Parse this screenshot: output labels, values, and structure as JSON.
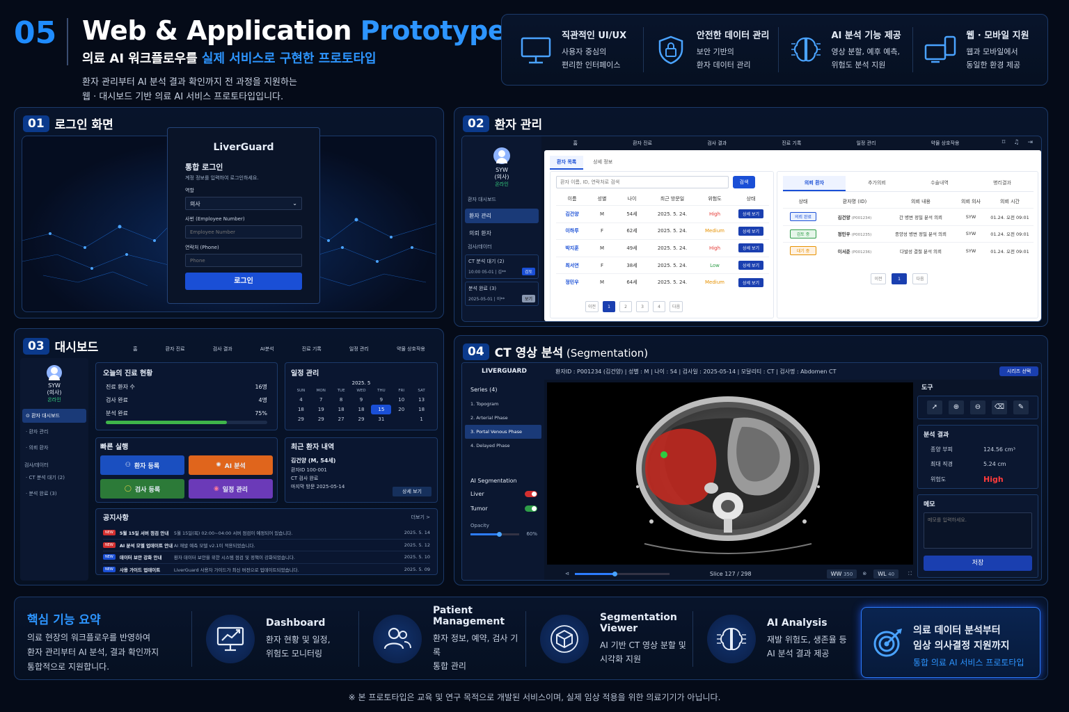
{
  "header": {
    "number": "05",
    "title_a": "Web & Application ",
    "title_b": "Prototype",
    "subtitle_a": "의료 AI 워크플로우를 ",
    "subtitle_b": "실제 서비스로 구현한 프로토타입",
    "desc1": "환자 관리부터 AI 분석 결과 확인까지 전 과정을 지원하는",
    "desc2": "웹 · 대시보드 기반 의료 AI 서비스 프로토타입입니다."
  },
  "features": [
    {
      "icon": "monitor-icon",
      "title": "직관적인 UI/UX",
      "l1": "사용자 중심의",
      "l2": "편리한 인터페이스"
    },
    {
      "icon": "shield-lock-icon",
      "title": "안전한 데이터 관리",
      "l1": "보안 기반의",
      "l2": "환자 데이터 관리"
    },
    {
      "icon": "brain-circuit-icon",
      "title": "AI 분석 기능 제공",
      "l1": "영상 분할, 예후 예측,",
      "l2": "위험도 분석 지원"
    },
    {
      "icon": "devices-icon",
      "title": "웹 · 모바일 지원",
      "l1": "웹과 모바일에서",
      "l2": "동일한 환경 제공"
    }
  ],
  "login": {
    "no": "01",
    "title": "로그인 화면",
    "brand": "LiverGuard",
    "heading": "통합 로그인",
    "hint": "계정 정보를 입력하여 로그인하세요.",
    "role_label": "역할",
    "role_value": "의사",
    "emp_label": "사번 (Employee Number)",
    "emp_ph": "Employee Number",
    "phone_label": "연락처 (Phone)",
    "phone_ph": "Phone",
    "submit": "로그인"
  },
  "patients": {
    "no": "02",
    "title": "환자 관리",
    "nav": [
      "홈",
      "환자 진료",
      "검사 결과",
      "진료 기록",
      "일정 관리",
      "약물 상호작용"
    ],
    "user": {
      "name": "SYW",
      "role": "(의사)",
      "status": "온라인"
    },
    "side": {
      "g1": "환자 대시보드",
      "i1": "환자 관리",
      "i2": "의뢰 환자",
      "g2": "검사/데이터",
      "c1": "CT 분석 대기 (2)",
      "c1sub": "10:00 05-01 | 김**",
      "c1tag": "검토",
      "c2": "분석 완료 (3)",
      "c2sub": "2025-05-01 | 이**",
      "c2tag": "보기"
    },
    "tabs": [
      "환자 목록",
      "상세 정보"
    ],
    "search_ph": "환자 이름, ID, 연락처로 검색",
    "search_btn": "검색",
    "cols": [
      "이름",
      "성별",
      "나이",
      "최근 방문일",
      "위험도",
      "상태"
    ],
    "rows": [
      {
        "name": "김건양",
        "sex": "M",
        "age": "54세",
        "date": "2025. 5. 24.",
        "risk": "High",
        "btn": "상세 보기"
      },
      {
        "name": "이하루",
        "sex": "F",
        "age": "62세",
        "date": "2025. 5. 24.",
        "risk": "Medium",
        "btn": "상세 보기"
      },
      {
        "name": "박지훈",
        "sex": "M",
        "age": "49세",
        "date": "2025. 5. 24.",
        "risk": "High",
        "btn": "상세 보기"
      },
      {
        "name": "최서연",
        "sex": "F",
        "age": "38세",
        "date": "2025. 5. 24.",
        "risk": "Low",
        "btn": "상세 보기"
      },
      {
        "name": "정민우",
        "sex": "M",
        "age": "64세",
        "date": "2025. 5. 24.",
        "risk": "Medium",
        "btn": "상세 보기"
      }
    ],
    "pager": [
      "이전",
      "1",
      "2",
      "3",
      "4",
      "다음"
    ],
    "rtabs": [
      "의뢰 환자",
      "추가의뢰",
      "수술내역",
      "병리결과"
    ],
    "rcols": [
      "상태",
      "환자명 (ID)",
      "의뢰 내용",
      "의뢰 의사",
      "의뢰 시간"
    ],
    "rrows": [
      {
        "st": "의뢰 완료",
        "name": "김건양",
        "id": "(P001234)",
        "content": "간 병변 정밀 분석 의뢰",
        "doc": "SYW",
        "time": "01.24. 오전 09:01"
      },
      {
        "st": "검토 중",
        "name": "정민우",
        "id": "(P001235)",
        "content": "종양성 병변 정밀 분석 의뢰",
        "doc": "SYW",
        "time": "01.24. 오전 09:01"
      },
      {
        "st": "대기 중",
        "name": "이서준",
        "id": "(P001236)",
        "content": "다발성 결절 분석 의뢰",
        "doc": "SYW",
        "time": "01.24. 오전 09:01"
      }
    ],
    "rpager": [
      "이전",
      "1",
      "다음"
    ]
  },
  "dashboard": {
    "no": "03",
    "title": "대시보드",
    "nav": [
      "홈",
      "환자 진료",
      "검사 결과",
      "AI분석",
      "진료 기록",
      "일정 관리",
      "약물 상호작용"
    ],
    "user": {
      "name": "SYW",
      "role": "(의사)",
      "status": "온라인"
    },
    "side": [
      "환자 대시보드",
      "환자 관리",
      "의뢰 환자",
      "검사/데이터",
      "CT 분석 대기 (2)",
      "분석 완료 (3)"
    ],
    "today": {
      "title": "오늘의 진료 현황",
      "r1": "진료 환자 수",
      "v1": "16명",
      "r2": "검사 완료",
      "v2": "4명",
      "r3": "분석 완료",
      "v3": "75%",
      "progress": 75
    },
    "schedule": {
      "title": "일정 관리",
      "month": "2025. 5",
      "days": [
        "SUN",
        "MON",
        "TUE",
        "WED",
        "THU",
        "FRI",
        "SAT"
      ],
      "w1": [
        "4",
        "7",
        "8",
        "9",
        "9",
        "10",
        "13"
      ],
      "w2": [
        "18",
        "19",
        "18",
        "18",
        "15",
        "20",
        "18"
      ],
      "w3": [
        "29",
        "29",
        "27",
        "29",
        "31",
        "",
        "1"
      ],
      "today_cell": "15"
    },
    "quick": {
      "title": "빠른 실행",
      "b1": "환자 등록",
      "b2": "AI 분석",
      "b3": "검사 등록",
      "b4": "일정 관리"
    },
    "recent": {
      "title": "최근 환자 내역",
      "name": "김건양 (M, 54세)",
      "l1": "환자ID 100-001",
      "l2": "CT 검사 완료",
      "l3": "마지막 방문 2025-05-14",
      "btn": "상세 보기"
    },
    "notice": {
      "title": "공지사항",
      "more": "더보기 >",
      "items": [
        {
          "tag": "NEW",
          "t": "5월 15일 서버 점검 안내",
          "d": "5월 15일(목) 02:00~04:00 서버 점검이 예정되어 있습니다.",
          "date": "2025. 5. 14"
        },
        {
          "tag": "NEW",
          "t": "AI 분석 모델 업데이트 안내",
          "d": "AI 재발 예측 모델 v2.1이 적용되었습니다.",
          "date": "2025. 5. 12"
        },
        {
          "tag": "NEW",
          "t": "데이터 보안 강화 안내",
          "d": "환자 데이터 보안을 위한 시스템 점검 및 정책이 강화되었습니다.",
          "date": "2025. 5. 10"
        },
        {
          "tag": "NEW",
          "t": "사용 가이드 업데이트",
          "d": "LiverGuard 사용자 가이드가 최신 버전으로 업데이트되었습니다.",
          "date": "2025. 5. 09"
        }
      ]
    }
  },
  "seg": {
    "no": "04",
    "title": "CT 영상 분석",
    "title_sub": " (Segmentation)",
    "brand": "LIVERGUARD",
    "info": "환자ID : P001234 (김건양)  |  성별 : M  |  나이 : 54  |  검사일 : 2025-05-14  |  모달리티 : CT  |  검사명 : Abdomen CT",
    "series_btn": "시리즈 선택",
    "series_title": "Series (4)",
    "series": [
      "1.  Topogram",
      "2.  Arterial Phase",
      "3.  Portal Venous Phase",
      "4.  Delayed Phase"
    ],
    "ai_title": "AI Segmentation",
    "liver": "Liver",
    "tumor": "Tumor",
    "opacity": "Opacity",
    "opacity_val": "60%",
    "slice": "Slice 127 / 298",
    "slice_pos": 127,
    "slice_total": 298,
    "ww": "WW",
    "ww_v": "350",
    "wl": "WL",
    "wl_v": "40",
    "tools": "도구",
    "result_title": "분석 결과",
    "r1": "종양 부피",
    "v1": "124.56 cm³",
    "r2": "최대 직경",
    "v2": "5.24 cm",
    "r3": "위험도",
    "v3": "High",
    "memo": "메모",
    "memo_ph": "메모를 입력하세요.",
    "save": "저장"
  },
  "summary": {
    "title": "핵심 기능 요약",
    "l1": "의료 현장의 워크플로우를 반영하여",
    "l2": "환자 관리부터 AI 분석, 결과 확인까지",
    "l3": "통합적으로 지원합니다.",
    "items": [
      {
        "icon": "chart-monitor-icon",
        "t": "Dashboard",
        "a": "환자 현황 및 일정,",
        "b": "위험도 모니터링"
      },
      {
        "icon": "users-icon",
        "t": "Patient Management",
        "a": "환자 정보, 예약, 검사 기록",
        "b": "통합 관리"
      },
      {
        "icon": "cube-icon",
        "t": "Segmentation Viewer",
        "a": "AI 기반 CT 영상 분할 및",
        "b": "시각화 지원"
      },
      {
        "icon": "brain-icon",
        "t": "AI Analysis",
        "a": "재발 위험도, 생존율 등",
        "b": "AI 분석 결과 제공"
      }
    ],
    "hl1": "의료 데이터 분석부터",
    "hl2": "임상 의사결정 지원까지",
    "hl3": "통합 의료 AI 서비스 프로토타입"
  },
  "footer": "※ 본 프로토타입은 교육 및 연구 목적으로 개발된 서비스이며, 실제 임상 적용을 위한 의료기기가 아닙니다."
}
